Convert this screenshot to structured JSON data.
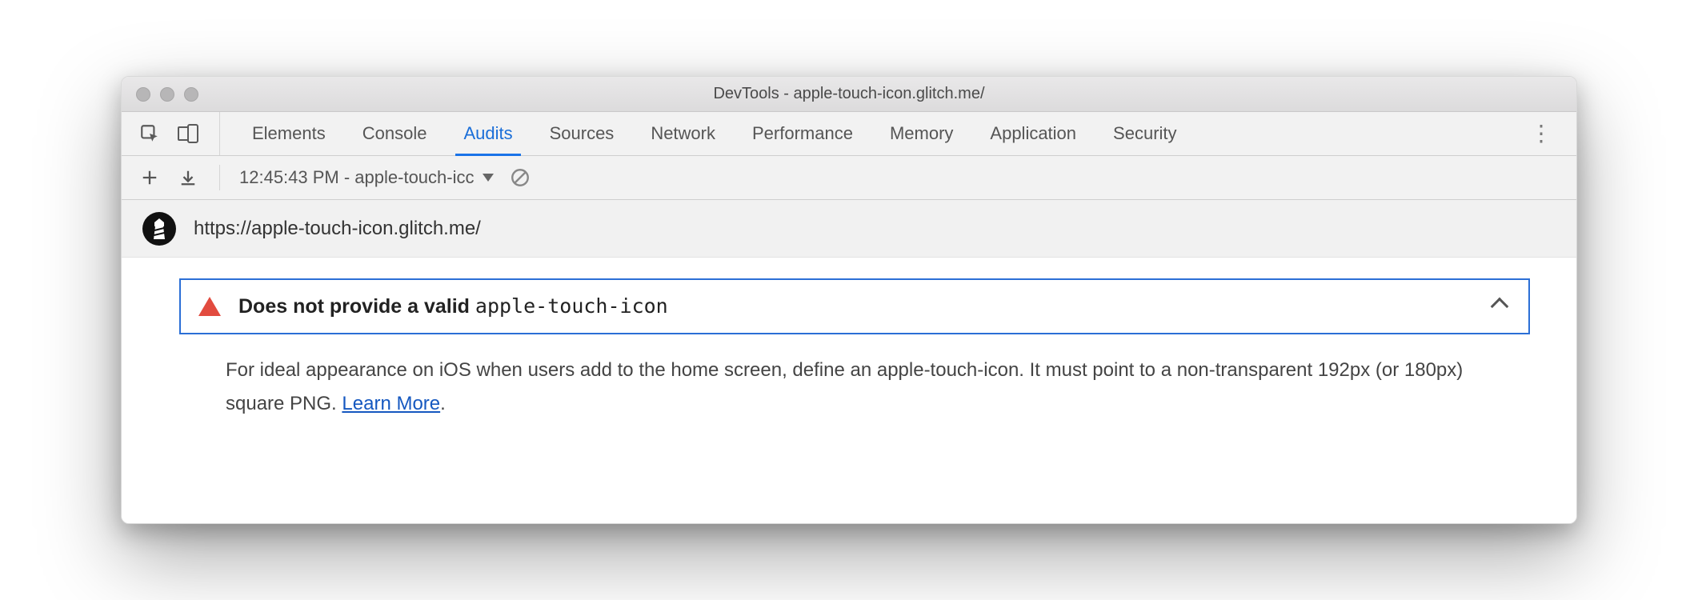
{
  "window": {
    "title": "DevTools - apple-touch-icon.glitch.me/"
  },
  "tabs": {
    "items": [
      "Elements",
      "Console",
      "Audits",
      "Sources",
      "Network",
      "Performance",
      "Memory",
      "Application",
      "Security"
    ],
    "active_index": 2
  },
  "toolbar": {
    "new_audit_label": "+",
    "report_label": "12:45:43 PM - apple-touch-icc"
  },
  "url_row": {
    "url": "https://apple-touch-icon.glitch.me/"
  },
  "audit": {
    "title_prefix": "Does not provide a valid ",
    "title_code": "apple-touch-icon",
    "description": "For ideal appearance on iOS when users add to the home screen, define an apple-touch-icon. It must point to a non-transparent 192px (or 180px) square PNG. ",
    "learn_more": "Learn More",
    "period": "."
  }
}
